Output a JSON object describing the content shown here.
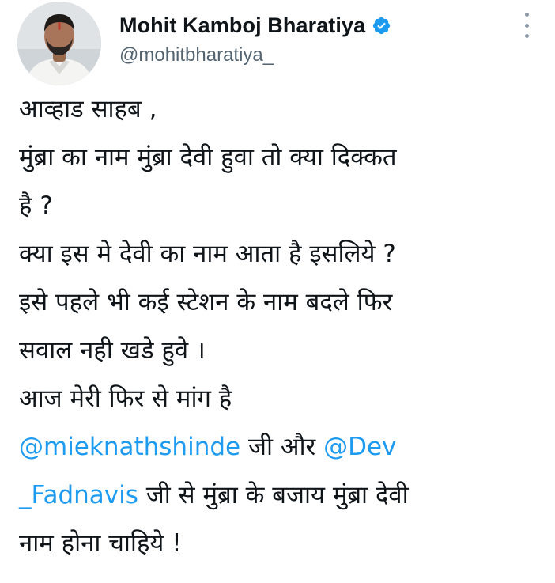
{
  "author": {
    "display_name": "Mohit Kamboj Bharatiya",
    "handle": "@mohitbharatiya_",
    "verified": true
  },
  "icons": {
    "verified": "verified-badge-icon",
    "more": "more-vertical-icon",
    "avatar": "profile-photo"
  },
  "colors": {
    "text": "#0f1419",
    "secondary": "#536471",
    "mention": "#1d9bf0",
    "verified": "#1d9bf0"
  },
  "tweet": {
    "lines": [
      "आव्हाड साहब ,",
      "मुंब्रा का नाम मुंब्रा देवी हुवा तो क्या दिक्कत",
      "है ?",
      "क्या इस मे देवी का नाम आता है इसलिये ?",
      "इसे पहले भी कई स्टेशन के नाम बदले फिर",
      "सवाल नही खडे हुवे ।",
      "आज मेरी फिर से मांग है"
    ],
    "mention_line_1": {
      "mention_a": "@mieknathshinde",
      "text_a": " जी और ",
      "mention_b_start": "@Dev"
    },
    "mention_line_2": {
      "mention_b_end": "_Fadnavis",
      "text_b": " जी से मुंब्रा के बजाय मुंब्रा देवी"
    },
    "last_line": "नाम होना चाहिये !"
  }
}
